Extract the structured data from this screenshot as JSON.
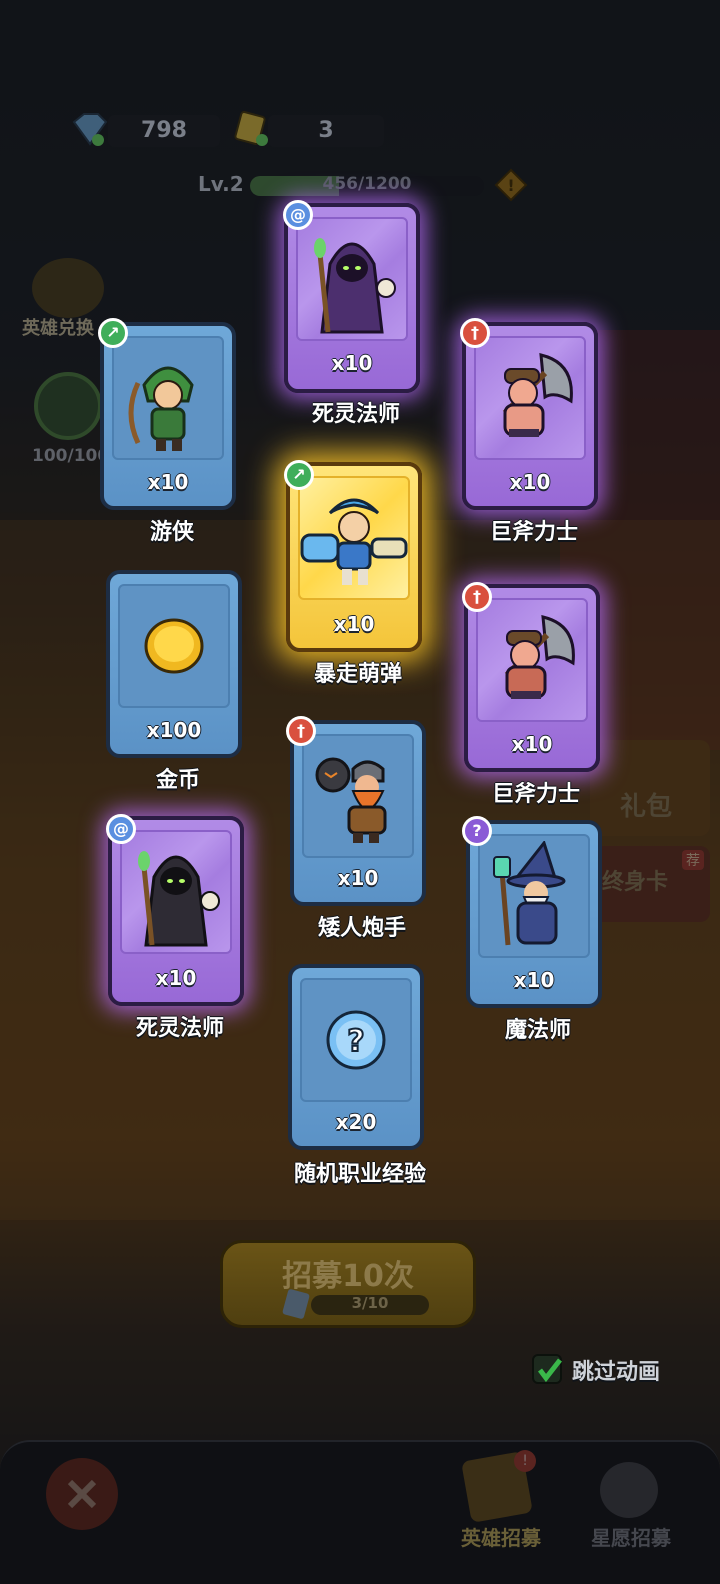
{
  "top": {
    "gems": "798",
    "tickets": "3"
  },
  "level": {
    "label": "Lv.2",
    "xp_text": "456/1200",
    "xp_fraction": 0.38
  },
  "side": {
    "hero_exchange": "英雄兑换",
    "progress": "100/100"
  },
  "cards": [
    {
      "id": "necro1",
      "qty": "x10",
      "name": "死灵法师",
      "rarity": "purple",
      "class_icon": "swirl-icon"
    },
    {
      "id": "ranger",
      "qty": "x10",
      "name": "游侠",
      "rarity": "blue",
      "class_icon": "bow-icon"
    },
    {
      "id": "axe1",
      "qty": "x10",
      "name": "巨斧力士",
      "rarity": "purple",
      "class_icon": "sword-icon"
    },
    {
      "id": "bomber",
      "qty": "x10",
      "name": "暴走萌弹",
      "rarity": "gold",
      "class_icon": "bow-icon"
    },
    {
      "id": "gold",
      "qty": "x100",
      "name": "金币",
      "rarity": "blue",
      "class_icon": ""
    },
    {
      "id": "axe2",
      "qty": "x10",
      "name": "巨斧力士",
      "rarity": "purple",
      "class_icon": "sword-icon"
    },
    {
      "id": "dwarf",
      "qty": "x10",
      "name": "矮人炮手",
      "rarity": "blue",
      "class_icon": "sword-icon"
    },
    {
      "id": "necro2",
      "qty": "x10",
      "name": "死灵法师",
      "rarity": "purple",
      "class_icon": "swirl-icon"
    },
    {
      "id": "mage",
      "qty": "x10",
      "name": "魔法师",
      "rarity": "blue",
      "class_icon": "staff-icon"
    },
    {
      "id": "exp",
      "qty": "x20",
      "name": "随机职业经验",
      "rarity": "blue",
      "class_icon": ""
    }
  ],
  "recruit": {
    "label": "招募10次",
    "progress": "3/10"
  },
  "skip_animation": "跳过动画",
  "shop": {
    "gift": "礼包",
    "card": "终身卡",
    "tag": "荐"
  },
  "tabs": {
    "hero_recruit": "英雄招募",
    "star_recruit": "星愿招募"
  },
  "colors": {
    "purple_glow": "#b96eff",
    "gold_glow": "#ffc828",
    "blue_card": "#5b92c6"
  }
}
